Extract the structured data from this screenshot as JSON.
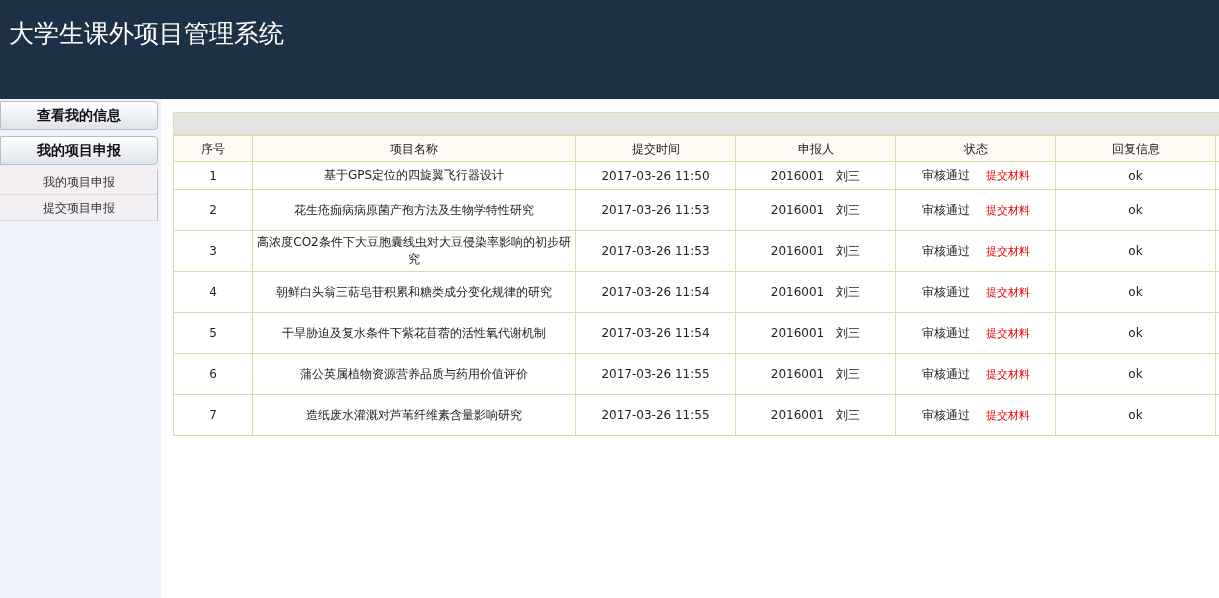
{
  "header": {
    "title": "大学生课外项目管理系统"
  },
  "sidebar": {
    "groups": [
      {
        "label": "查看我的信息"
      },
      {
        "label": "我的项目申报",
        "items": [
          "我的项目申报",
          "提交项目申报"
        ]
      }
    ]
  },
  "table": {
    "columns": [
      "序号",
      "项目名称",
      "提交时间",
      "申报人",
      "状态",
      "回复信息"
    ],
    "rows": [
      {
        "index": "1",
        "name": "基于GPS定位的四旋翼飞行器设计",
        "time": "2017-03-26 11:50",
        "applicant_id": "2016001",
        "applicant_name": "刘三",
        "status": "审核通过",
        "action": "提交材料",
        "reply": "ok"
      },
      {
        "index": "2",
        "name": "花生疮痂病病原菌产孢方法及生物学特性研究",
        "time": "2017-03-26 11:53",
        "applicant_id": "2016001",
        "applicant_name": "刘三",
        "status": "审核通过",
        "action": "提交材料",
        "reply": "ok"
      },
      {
        "index": "3",
        "name": "高浓度CO2条件下大豆胞囊线虫对大豆侵染率影响的初步研究",
        "time": "2017-03-26 11:53",
        "applicant_id": "2016001",
        "applicant_name": "刘三",
        "status": "审核通过",
        "action": "提交材料",
        "reply": "ok"
      },
      {
        "index": "4",
        "name": "朝鲜白头翁三萜皂苷积累和糖类成分变化规律的研究",
        "time": "2017-03-26 11:54",
        "applicant_id": "2016001",
        "applicant_name": "刘三",
        "status": "审核通过",
        "action": "提交材料",
        "reply": "ok"
      },
      {
        "index": "5",
        "name": "干旱胁迫及复水条件下紫花苜蓿的活性氧代谢机制",
        "time": "2017-03-26 11:54",
        "applicant_id": "2016001",
        "applicant_name": "刘三",
        "status": "审核通过",
        "action": "提交材料",
        "reply": "ok"
      },
      {
        "index": "6",
        "name": "蒲公英属植物资源营养品质与药用价值评价",
        "time": "2017-03-26 11:55",
        "applicant_id": "2016001",
        "applicant_name": "刘三",
        "status": "审核通过",
        "action": "提交材料",
        "reply": "ok"
      },
      {
        "index": "7",
        "name": "造纸废水灌溉对芦苇纤维素含量影响研究",
        "time": "2017-03-26 11:55",
        "applicant_id": "2016001",
        "applicant_name": "刘三",
        "status": "审核通过",
        "action": "提交材料",
        "reply": "ok"
      }
    ]
  }
}
